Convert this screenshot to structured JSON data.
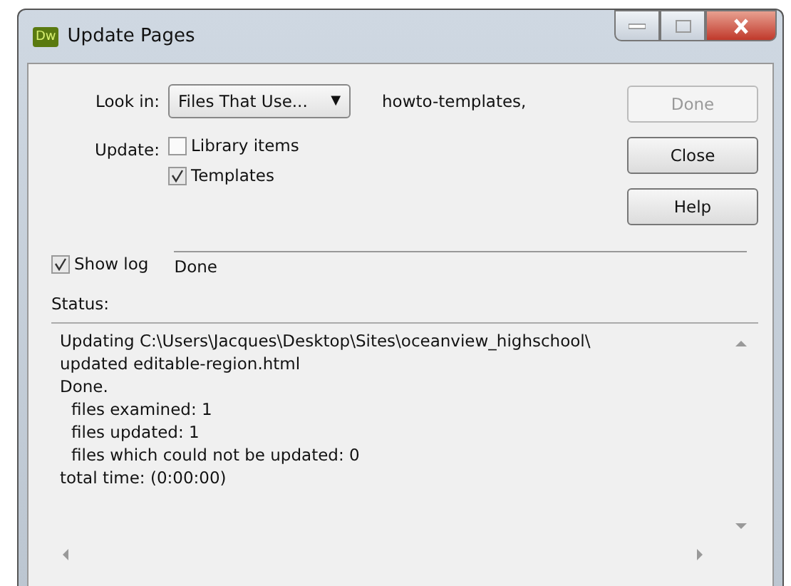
{
  "window": {
    "title": "Update Pages",
    "app_badge": "Dw"
  },
  "look_in": {
    "label": "Look in:",
    "value": "Files That Use...",
    "arrow": "▼",
    "target": "howto-templates,"
  },
  "update": {
    "label": "Update:",
    "options": [
      {
        "label": "Library items",
        "checked": false
      },
      {
        "label": "Templates",
        "checked": true
      }
    ]
  },
  "buttons": [
    {
      "label": "Done",
      "disabled": true
    },
    {
      "label": "Close",
      "disabled": false
    },
    {
      "label": "Help",
      "disabled": false
    }
  ],
  "show_log": {
    "label": "Show log",
    "checked": true,
    "value": "Done"
  },
  "status": {
    "label": "Status:",
    "lines": [
      {
        "kind": "line",
        "text": "Updating C:\\Users\\Jacques\\Desktop\\Sites\\oceanview_highschool\\"
      },
      {
        "kind": "line",
        "text": "updated editable-region.html"
      },
      {
        "kind": "line",
        "text": "Done."
      },
      {
        "kind": "detail",
        "text": "files examined: 1"
      },
      {
        "kind": "detail",
        "text": "files updated: 1"
      },
      {
        "kind": "detail",
        "text": "files which could not be updated: 0"
      },
      {
        "kind": "line",
        "text": "total time: (0:00:00)"
      }
    ]
  }
}
